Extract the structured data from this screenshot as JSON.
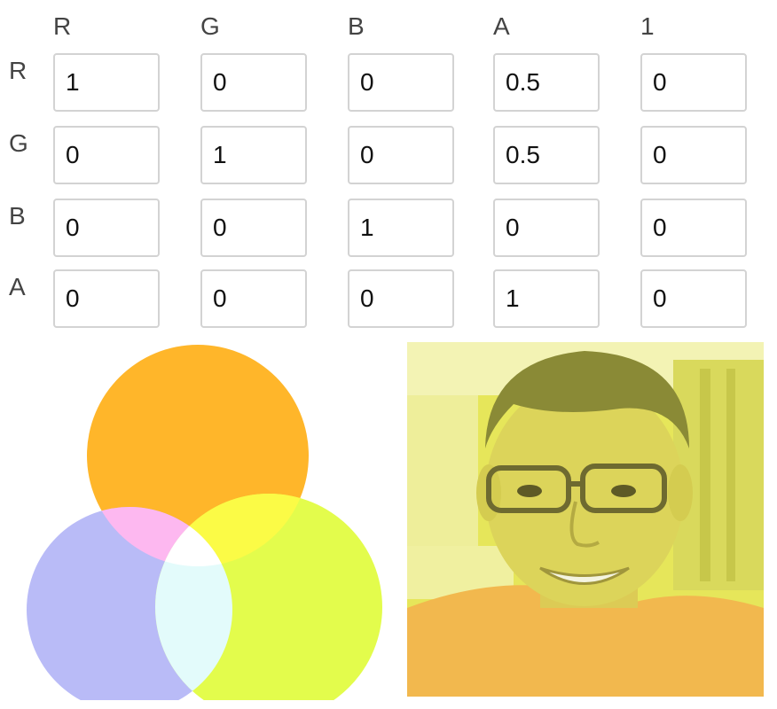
{
  "matrix": {
    "column_headers": [
      "R",
      "G",
      "B",
      "A",
      "1"
    ],
    "row_headers": [
      "R",
      "G",
      "B",
      "A"
    ],
    "rows": [
      [
        "1",
        "0",
        "0",
        "0.5",
        "0"
      ],
      [
        "0",
        "1",
        "0",
        "0.5",
        "0"
      ],
      [
        "0",
        "0",
        "1",
        "0",
        "0"
      ],
      [
        "0",
        "0",
        "0",
        "1",
        "0"
      ]
    ]
  },
  "colors": {
    "circle_top": "#ffb62a",
    "circle_left": "#b9bbf7",
    "circle_right": "#e3fc4c",
    "overlap_top_left": "#fdb8f0",
    "overlap_top_right": "#fbfb46",
    "overlap_left_right": "#e3fbfb",
    "overlap_center": "#ffffff",
    "photo_tint": "#e6e65a"
  }
}
